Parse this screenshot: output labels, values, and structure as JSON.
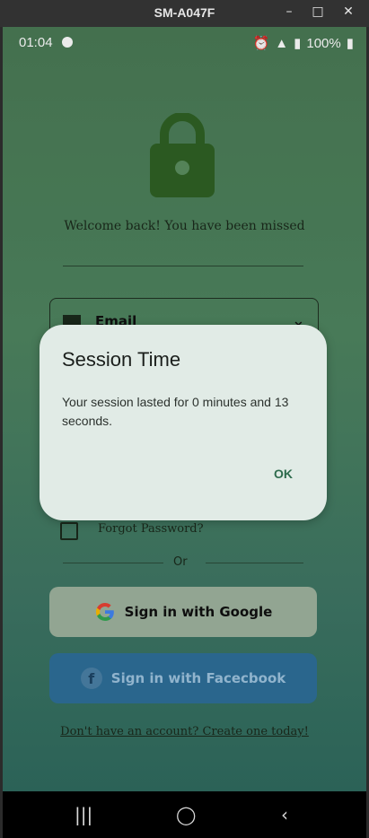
{
  "window": {
    "title": "SM-A047F",
    "min": "–",
    "max": "□",
    "close": "✕"
  },
  "status_bar": {
    "time": "01:04",
    "battery": "100%"
  },
  "login": {
    "welcome": "Welcome back! You have been missed",
    "email_label": "Email",
    "forgot_password": "Forgot Password?",
    "or": "Or",
    "google_button": "Sign in with Google",
    "facebook_button": "Sign in with Facecbook",
    "create_account": "Don't have an account? Create one today!"
  },
  "dialog": {
    "title": "Session Time",
    "body": "Your session lasted for 0 minutes and 13 seconds.",
    "ok": "OK"
  },
  "icons": {
    "lock": "lock-icon",
    "email": "mail-icon",
    "chevron": "chevron-down-icon",
    "google": "google-icon",
    "facebook": "facebook-icon"
  },
  "colors": {
    "accent_green": "#2e6b4d",
    "facebook": "#2e6f9a"
  }
}
